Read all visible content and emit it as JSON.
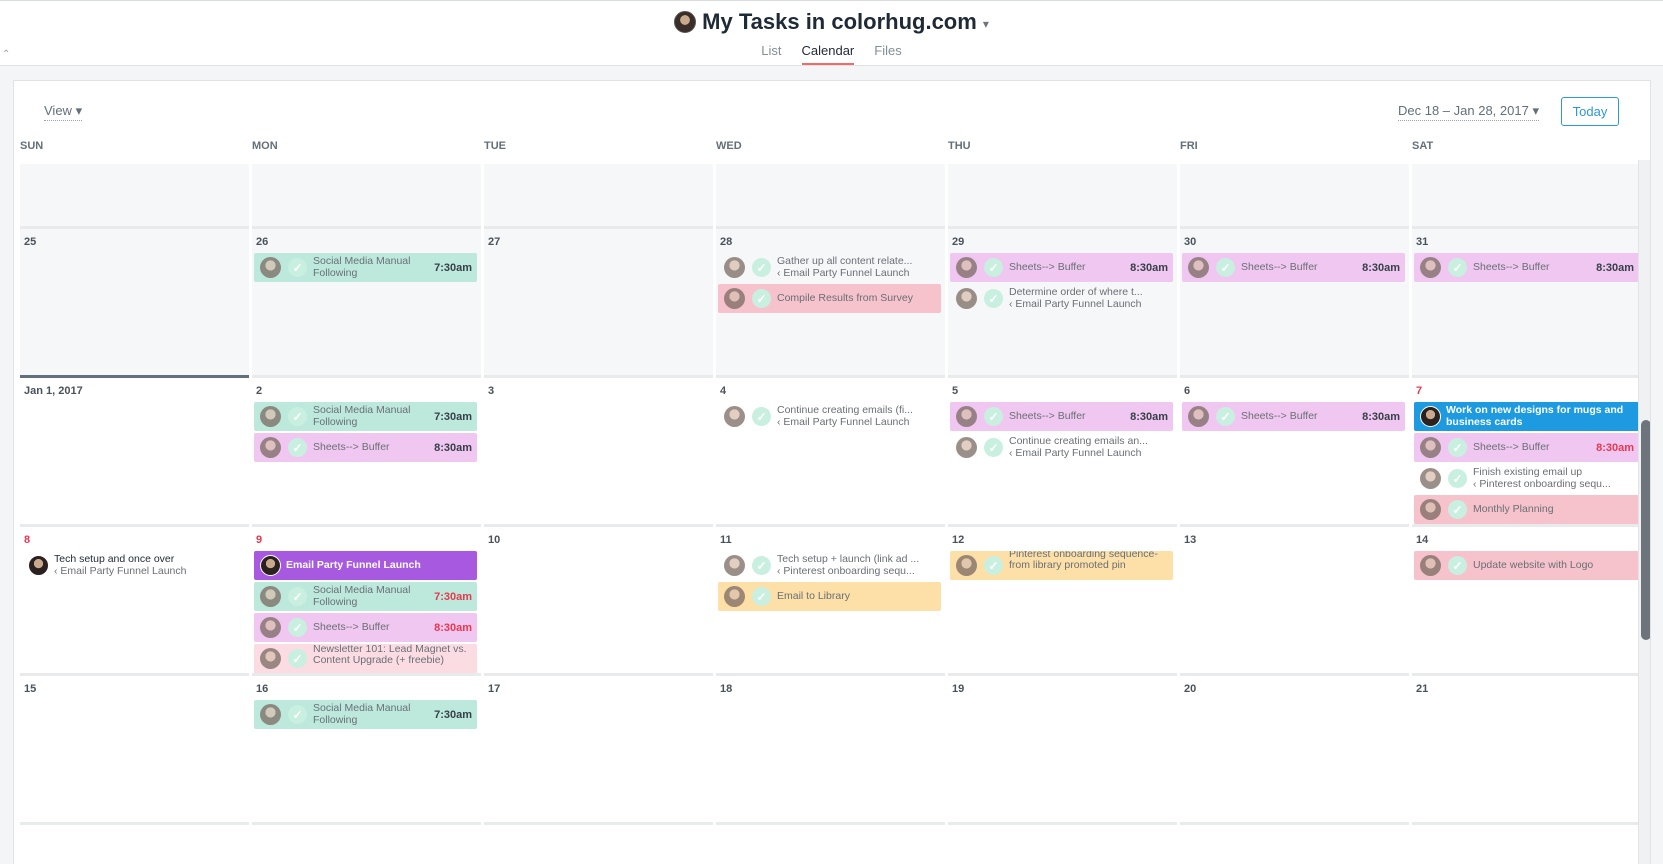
{
  "header": {
    "title": "My Tasks in colorhug.com",
    "tabs": [
      "List",
      "Calendar",
      "Files"
    ],
    "active_tab": "Calendar"
  },
  "toolbar": {
    "view_label": "View",
    "range_label": "Dec 18 – Jan 28, 2017",
    "today_label": "Today"
  },
  "weekdays": [
    "SUN",
    "MON",
    "TUE",
    "WED",
    "THU",
    "FRI",
    "SAT"
  ],
  "days": {
    "d25": "25",
    "d26": "26",
    "d27": "27",
    "d28": "28",
    "d29": "29",
    "d30": "30",
    "d31": "31",
    "d1": "Jan 1, 2017",
    "d2": "2",
    "d3": "3",
    "d4": "4",
    "d5": "5",
    "d6": "6",
    "d7": "7",
    "d8": "8",
    "d9": "9",
    "d10": "10",
    "d11": "11",
    "d12": "12",
    "d13": "13",
    "d14": "14",
    "d15": "15",
    "d16": "16",
    "d17": "17",
    "d18": "18",
    "d19": "19",
    "d20": "20",
    "d21": "21"
  },
  "tasks": {
    "smm_name": "Social Media Manual Following",
    "smm_time": "7:30am",
    "buffer_name": "Sheets--> Buffer",
    "buffer_time": "8:30am",
    "gather_name": "Gather up all content relate...",
    "project_email": "Email Party Funnel Launch",
    "project_pinterest": "Pinterest onboarding sequ...",
    "compile_name": "Compile Results from Survey",
    "determine_name": "Determine order of where t...",
    "continue_wed": "Continue creating emails (fi...",
    "continue_thu": "Continue creating emails an...",
    "work_name": "Work on new designs for mugs and business cards",
    "finish_name": "Finish existing email up",
    "monthly_name": "Monthly Planning",
    "tech_sun": "Tech setup and once over",
    "epfl_name": "Email Party Funnel Launch",
    "newsletter_name": "Newsletter 101: Lead Magnet vs. Content Upgrade (+ freebie)",
    "techad_name": "Tech setup + launch (link ad ...",
    "library_name": "Email to Library",
    "pinterest_lib_name": "Pinterest onboarding sequence- from library promoted pin",
    "website_name": "Update website with Logo"
  }
}
